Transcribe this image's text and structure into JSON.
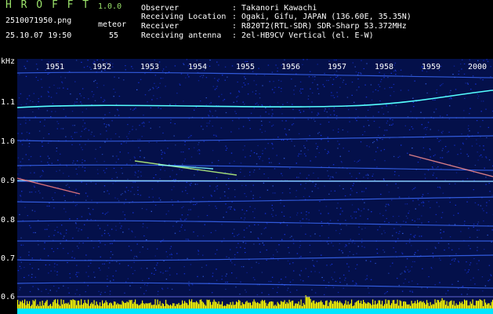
{
  "app": {
    "title_letters": "H R O F F T",
    "version": "1.0.0",
    "filename": "2510071950.png",
    "datetime": "25.10.07 19:50",
    "meteor_label": "meteor",
    "meteor_count": "55"
  },
  "info": {
    "labels": [
      "Observer",
      "Receiving Location",
      "Receiver",
      "Receiving antenna"
    ],
    "values": [
      ": Takanori Kawachi",
      ": Ogaki, Gifu, JAPAN (136.60E, 35.35N)",
      ": R820T2(RTL-SDR) SDR-Sharp 53.372MHz",
      ": 2el-HB9CV Vertical (el. E-W)"
    ]
  },
  "axes": {
    "y_unit": "kHz",
    "y_ticks": [
      "1.1",
      "1.0",
      "0.9",
      "0.8",
      "0.7",
      "0.6"
    ],
    "x_ticks": [
      "1951",
      "1952",
      "1953",
      "1954",
      "1955",
      "1956",
      "1957",
      "1958",
      "1959",
      "2000"
    ]
  },
  "colors": {
    "background": "#000000",
    "spectrogram_bg": "#04104a",
    "noise": "#1a3cff",
    "signal": "#55ffff",
    "bars_yellow": "#ffff00",
    "bars_cyan": "#00e5ff"
  }
}
